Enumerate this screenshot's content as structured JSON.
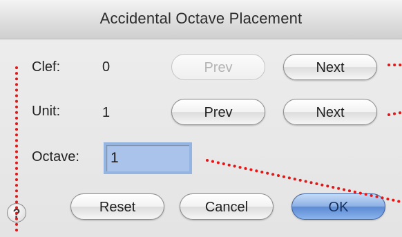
{
  "dialog": {
    "title": "Accidental Octave Placement"
  },
  "clef": {
    "label": "Clef:",
    "value": "0",
    "prev_label": "Prev",
    "next_label": "Next"
  },
  "unit": {
    "label": "Unit:",
    "value": "1",
    "prev_label": "Prev",
    "next_label": "Next"
  },
  "octave": {
    "label": "Octave:",
    "value": "1"
  },
  "footer": {
    "help_label": "?",
    "reset_label": "Reset",
    "cancel_label": "Cancel",
    "ok_label": "OK"
  },
  "colors": {
    "annotation_dots": "#e01818",
    "default_button": "#5d8bd4",
    "field_selection": "#a9c3ea"
  },
  "icons": {
    "help": "question-mark"
  }
}
